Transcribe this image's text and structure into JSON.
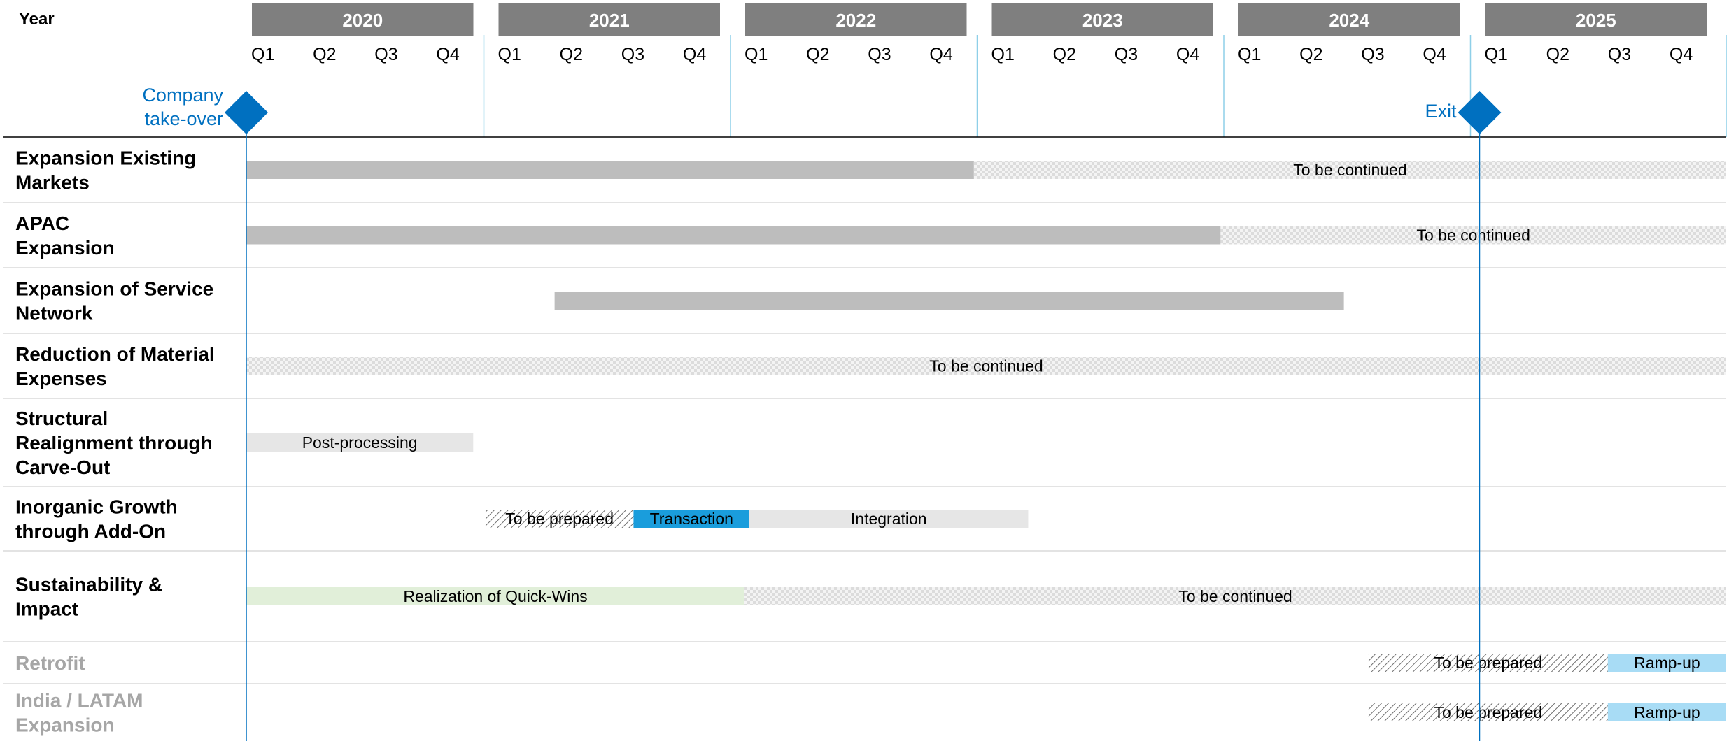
{
  "chart_data": {
    "type": "gantt",
    "title": "",
    "year_column_label": "Year",
    "years": [
      "2020",
      "2021",
      "2022",
      "2023",
      "2024",
      "2025"
    ],
    "quarters": [
      "Q1",
      "Q2",
      "Q3",
      "Q4"
    ],
    "milestones": [
      {
        "label": "Company take-over",
        "lines": [
          "Company",
          "take-over"
        ],
        "time": 2020.0
      },
      {
        "label": "Exit",
        "lines": [
          "Exit"
        ],
        "time": 2025.0
      }
    ],
    "rows": [
      {
        "name": "Expansion Existing Markets",
        "lines": [
          "Expansion Existing",
          "Markets"
        ],
        "muted": false,
        "bars": [
          {
            "start": 2020.0,
            "end": 2022.95,
            "style": "solid-gray",
            "label": ""
          },
          {
            "start": 2022.95,
            "end": 2026.0,
            "style": "continued",
            "label": "To be continued"
          }
        ]
      },
      {
        "name": "APAC Expansion",
        "lines": [
          "APAC",
          "Expansion"
        ],
        "muted": false,
        "bars": [
          {
            "start": 2020.0,
            "end": 2023.95,
            "style": "solid-gray",
            "label": ""
          },
          {
            "start": 2023.95,
            "end": 2026.0,
            "style": "continued",
            "label": "To be continued"
          }
        ]
      },
      {
        "name": "Expansion of Service Network",
        "lines": [
          "Expansion of Service",
          "Network"
        ],
        "muted": false,
        "bars": [
          {
            "start": 2021.25,
            "end": 2024.45,
            "style": "solid-gray",
            "label": ""
          }
        ]
      },
      {
        "name": "Reduction of Material Expenses",
        "lines": [
          "Reduction of Material",
          "Expenses"
        ],
        "muted": false,
        "bars": [
          {
            "start": 2020.0,
            "end": 2026.0,
            "style": "continued",
            "label": "To be continued"
          }
        ]
      },
      {
        "name": "Structural Realignment through Carve-Out",
        "lines": [
          "Structural",
          "Realignment through",
          "Carve-Out"
        ],
        "muted": false,
        "bars": [
          {
            "start": 2020.0,
            "end": 2020.92,
            "style": "light-gray",
            "label": "Post-processing"
          }
        ]
      },
      {
        "name": "Inorganic Growth through Add-On",
        "lines": [
          "Inorganic Growth",
          "through Add-On"
        ],
        "muted": false,
        "bars": [
          {
            "start": 2020.97,
            "end": 2021.57,
            "style": "hatched",
            "label": "To be prepared"
          },
          {
            "start": 2021.57,
            "end": 2022.04,
            "style": "blue",
            "label": "Transaction"
          },
          {
            "start": 2022.04,
            "end": 2023.17,
            "style": "light-gray",
            "label": "Integration"
          }
        ]
      },
      {
        "name": "Sustainability & Impact",
        "lines": [
          "Sustainability &",
          "Impact"
        ],
        "muted": false,
        "bars": [
          {
            "start": 2020.0,
            "end": 2022.02,
            "style": "light-green",
            "label": "Realization of Quick-Wins"
          },
          {
            "start": 2022.02,
            "end": 2026.0,
            "style": "continued",
            "label": "To be continued"
          }
        ]
      },
      {
        "name": "Retrofit",
        "lines": [
          "Retrofit"
        ],
        "muted": true,
        "bars": [
          {
            "start": 2024.55,
            "end": 2025.52,
            "style": "hatched",
            "label": "To be prepared"
          },
          {
            "start": 2025.52,
            "end": 2026.0,
            "style": "light-blue",
            "label": "Ramp-up"
          }
        ]
      },
      {
        "name": "India / LATAM Expansion",
        "lines": [
          "India / LATAM",
          "Expansion"
        ],
        "muted": true,
        "bars": [
          {
            "start": 2024.55,
            "end": 2025.52,
            "style": "hatched",
            "label": "To be prepared"
          },
          {
            "start": 2025.52,
            "end": 2026.0,
            "style": "light-blue",
            "label": "Ramp-up"
          }
        ]
      }
    ],
    "colors": {
      "year_header": "#7f7f7f",
      "accent_blue": "#0070c0",
      "separator": "#8ecfe8",
      "solid_gray": "#bdbdbd",
      "light_gray": "#e6e6e6",
      "continued_gray": "#e2e2e2",
      "blue_bar": "#1a9ddc",
      "light_blue": "#a8dcf5",
      "light_green": "#e1efd9",
      "muted_text": "#a6a6a6",
      "text": "#000000"
    }
  }
}
